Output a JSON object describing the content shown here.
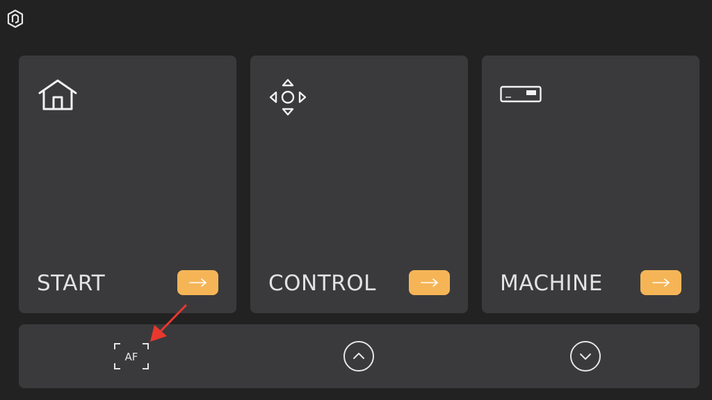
{
  "icons": {
    "logo": "app-logo-icon",
    "start": "home-icon",
    "control": "direction-pad-icon",
    "machine": "machine-panel-icon",
    "arrow": "arrow-right-icon",
    "autofocus": "autofocus-icon",
    "up": "chevron-up-circle-icon",
    "down": "chevron-down-circle-icon"
  },
  "cards": [
    {
      "label": "START"
    },
    {
      "label": "CONTROL"
    },
    {
      "label": "MACHINE"
    }
  ],
  "bottom_bar": {
    "autofocus_label": "AF"
  },
  "colors": {
    "background": "#222222",
    "card": "#3a3a3c",
    "accent": "#f5b557",
    "text": "#e2e2e2",
    "annotation_arrow": "#e8382e"
  }
}
